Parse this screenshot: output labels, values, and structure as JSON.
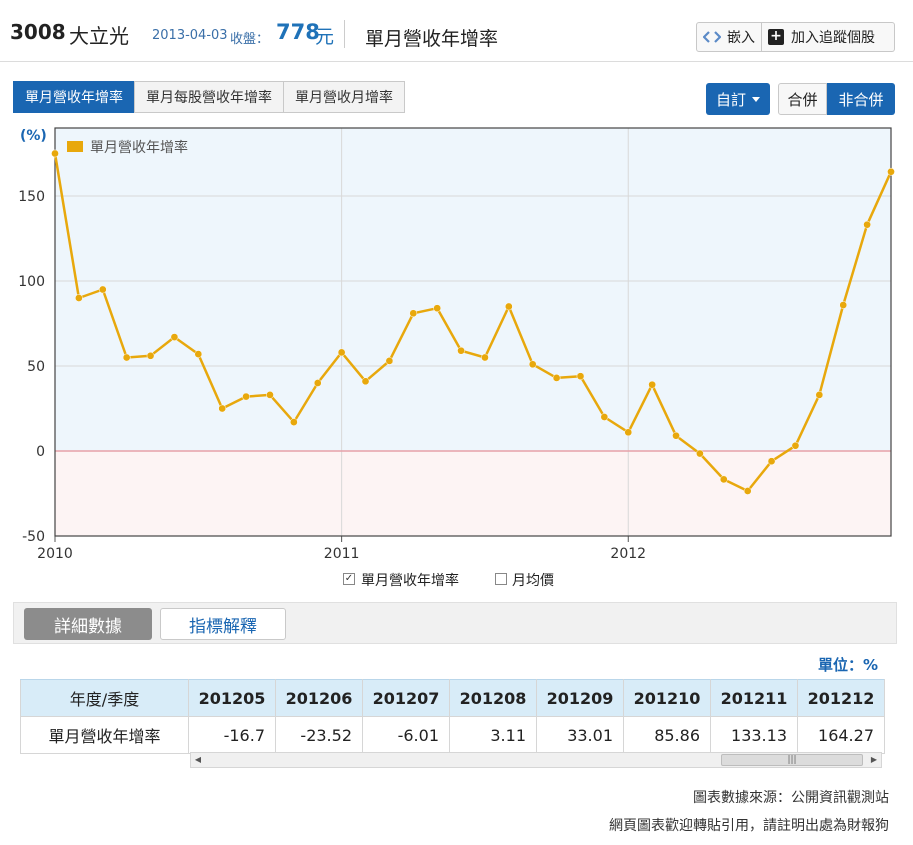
{
  "header": {
    "stock_code": "3008",
    "stock_name": "大立光",
    "price_date": "2013-04-03",
    "price_label": "收盤：",
    "price_value": "778",
    "price_unit": "元",
    "page_title": "單月營收年增率",
    "embed_label": "嵌入",
    "follow_label": "加入追蹤個股"
  },
  "tabs": [
    {
      "label": "單月營收年增率",
      "active": true
    },
    {
      "label": "單月每股營收年增率",
      "active": false
    },
    {
      "label": "單月營收月增率",
      "active": false
    }
  ],
  "controls": {
    "custom_label": "自訂",
    "merge_label": "合併",
    "nonmerge_label": "非合併",
    "selected": "非合併"
  },
  "colors": {
    "series": "#e8a80c",
    "accent": "#1a66b2",
    "zero_line": "#e7a0a8",
    "positive_fill": "#eef6fc",
    "negative_fill": "#fdf4f4"
  },
  "chart_data": {
    "type": "line",
    "ylabel": "(%)",
    "legend": [
      "單月營收年增率"
    ],
    "legend_placement": "top-left",
    "grid": true,
    "ylim": [
      -50,
      190
    ],
    "yticks": [
      -50,
      0,
      50,
      100,
      150
    ],
    "xticks": [
      "2010",
      "2011",
      "2012"
    ],
    "series": [
      {
        "name": "單月營收年增率",
        "x": [
          "201001",
          "201002",
          "201003",
          "201004",
          "201005",
          "201006",
          "201007",
          "201008",
          "201009",
          "201010",
          "201011",
          "201012",
          "201101",
          "201102",
          "201103",
          "201104",
          "201105",
          "201106",
          "201107",
          "201108",
          "201109",
          "201110",
          "201111",
          "201112",
          "201201",
          "201202",
          "201203",
          "201204",
          "201205",
          "201206",
          "201207",
          "201208",
          "201209",
          "201210",
          "201211",
          "201212"
        ],
        "values": [
          175,
          90,
          95,
          55,
          56,
          67,
          57,
          25,
          32,
          33,
          17,
          40,
          58,
          41,
          53,
          81,
          84,
          59,
          55,
          85,
          51,
          43,
          44,
          20,
          11,
          39,
          9,
          -1.5,
          -16.7,
          -23.52,
          -6.01,
          3.11,
          33.01,
          85.86,
          133.13,
          164.27
        ]
      }
    ]
  },
  "legend_checks": [
    {
      "label": "單月營收年增率",
      "checked": true
    },
    {
      "label": "月均價",
      "checked": false
    }
  ],
  "detail": {
    "detail_label": "詳細數據",
    "explain_label": "指標解釋",
    "unit_label": "單位：%"
  },
  "table": {
    "corner": "年度/季度",
    "row_label": "單月營收年增率",
    "columns": [
      "201205",
      "201206",
      "201207",
      "201208",
      "201209",
      "201210",
      "201211",
      "201212"
    ],
    "values": [
      "-16.7",
      "-23.52",
      "-6.01",
      "3.11",
      "33.01",
      "85.86",
      "133.13",
      "164.27"
    ]
  },
  "footer": {
    "source": "圖表數據來源：公開資訊觀測站",
    "notice": "網頁圖表歡迎轉貼引用，請註明出處為財報狗"
  }
}
